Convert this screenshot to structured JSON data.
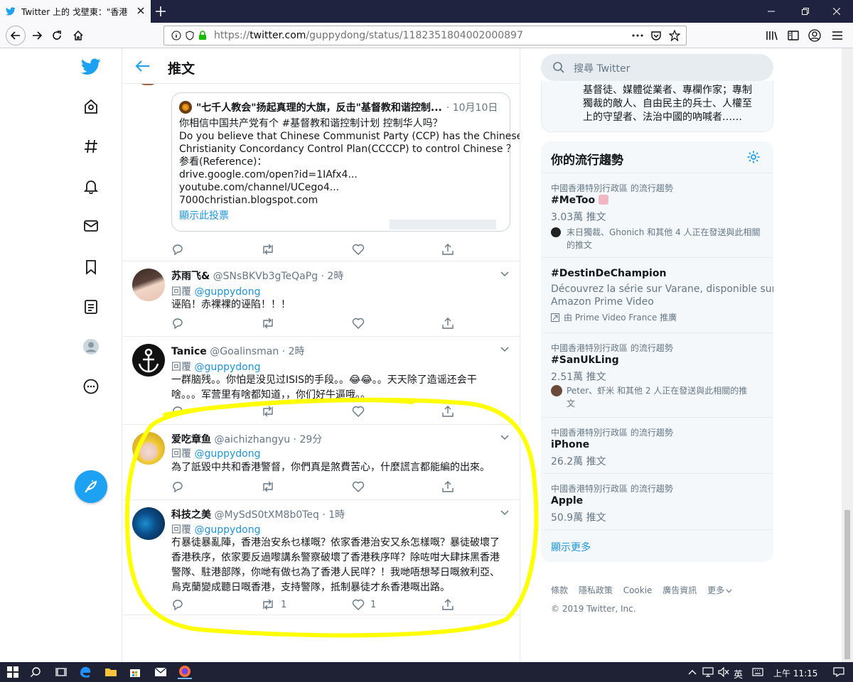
{
  "browser": {
    "tab_title": "Twitter 上的 戈壁東：\"香港中文",
    "url_prefix": "https://",
    "url_host": "twitter.com",
    "url_path": "/guppydong/status/1182351804002000897"
  },
  "header": {
    "title": "推文"
  },
  "quoted": {
    "title": "\"七千人教会\"扬起真理的大旗，反击\"基督教和谐控制...",
    "date": "· 10月10日",
    "lines": [
      "你相信中国共产党有个 #基督教和谐控制计划 控制华人吗？",
      "Do you believe that Chinese Communist Party (CCP) has the  Chinese",
      "Christianity Concordancy Control Plan(CCCCP) to control Chinese ？",
      "参看(Reference)：",
      "drive.google.com/open?id=1IAfx4...",
      "youtube.com/channel/UCego4...",
      "7000christian.blogspot.com"
    ],
    "show_poll": "顯示此投票"
  },
  "tweets": [
    {
      "name": "苏雨飞&",
      "meta": "@SNsBKVb3gTeQaPg · 2時",
      "reply_prefix": "回覆",
      "reply_to": "@guppydong",
      "lines": [
        "诬陷！赤裸裸的诬陷！！！"
      ],
      "retweets": "",
      "likes": ""
    },
    {
      "name": "Tanice",
      "meta": "@Goalinsman · 2時",
      "reply_prefix": "回覆",
      "reply_to": "@guppydong",
      "lines": [
        "一群脑残。。你怕是没见过ISIS的手段。。😂😂。。天天除了造谣还会干",
        "啥。。。军营里有啥都知道，，你们好牛逼哦。。"
      ],
      "retweets": "",
      "likes": ""
    },
    {
      "name": "爱吃章鱼",
      "meta": "@aichizhangyu · 29分",
      "reply_prefix": "回覆",
      "reply_to": "@guppydong",
      "lines": [
        "為了詆毀中共和香港警督，你們真是煞費苦心，什麼謊言都能編的出來。"
      ],
      "retweets": "",
      "likes": ""
    },
    {
      "name": "科技之美",
      "meta": "@MySdS0tXM8b0Teq · 1時",
      "reply_prefix": "回覆",
      "reply_to": "@guppydong",
      "lines": [
        "冇暴徒暴亂陣，香港治安糸乜樣嘅？依家香港治安又糸怎樣嘅？暴徒破壞了",
        "香港秩序，依家要反過嚟講糸警察破壞了香港秩序咩？除咗咁大肆抹黑香港",
        "警隊、駐港部隊，你哋有做乜為了香港人民咩？！我哋唔想琴日嘅敘利亞、",
        "烏克蘭變成聽日嘅香港，支持警隊，抵制暴徒才糸香港嘅出路。"
      ],
      "retweets": "1",
      "likes": "1"
    }
  ],
  "search": {
    "placeholder": "搜尋 Twitter"
  },
  "who_to_follow": {
    "bio_lines": [
      "基督徒、媒體從業者、專欄作家；專制",
      "獨裁的敵人、自由民主的兵士、人權至",
      "上的守望者、法治中國的吶喊者……"
    ]
  },
  "trends": {
    "title": "你的流行趨勢",
    "items": [
      {
        "context": "中國香港特別行政區 的流行趨勢",
        "name": "#MeToo",
        "count": "3.03萬 推文",
        "people": [
          "末日獨裁、Ghonich 和其他 4 人正在發送與此相關",
          "的推文"
        ]
      },
      {
        "context": "",
        "name": "#DestinDeChampion",
        "count": "",
        "desc": [
          "Découvrez la série sur Varane, disponible sur",
          "Amazon Prime Video"
        ],
        "promoted": "由 Prime Video France 推廣"
      },
      {
        "context": "中國香港特別行政區 的流行趨勢",
        "name": "#SanUkLing",
        "count": "2.51萬 推文",
        "people": [
          "Peter、虾米 和其他 2 人正在發送與此相關的推",
          "文"
        ]
      },
      {
        "context": "中國香港特別行政區 的流行趨勢",
        "name": "iPhone",
        "count": "26.2萬 推文"
      },
      {
        "context": "中國香港特別行政區 的流行趨勢",
        "name": "Apple",
        "count": "50.9萬 推文"
      }
    ],
    "show_more": "顯示更多"
  },
  "footer": {
    "links": [
      "條款",
      "隱私政策",
      "Cookie",
      "廣告資訊",
      "更多"
    ],
    "copyright": "© 2019 Twitter, Inc."
  },
  "taskbar": {
    "ime": "英",
    "clock": "上午 11:15"
  },
  "colors": {
    "twitter_blue": "#1da1f2",
    "link_blue": "#1b95e0",
    "annotation_yellow": "#ffff00",
    "tabbar": "#202340",
    "taskbar": "#1f2235"
  }
}
